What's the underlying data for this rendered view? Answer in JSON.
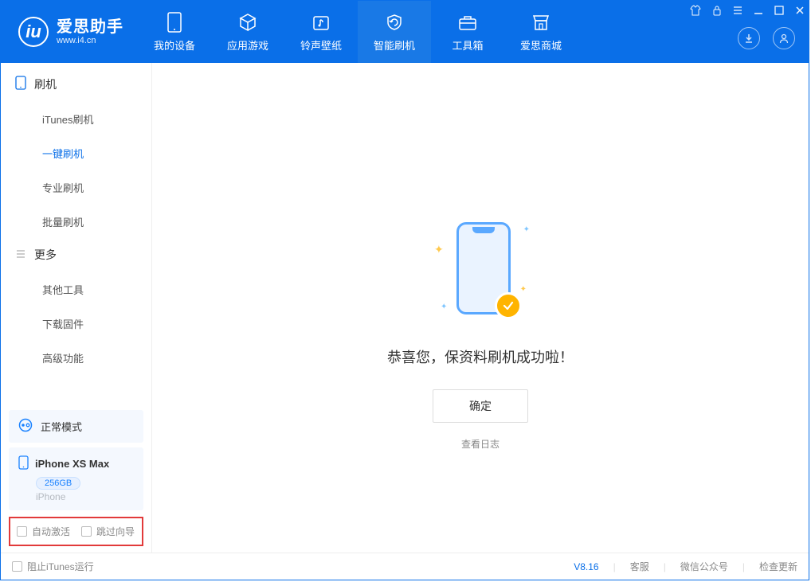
{
  "brand": {
    "name": "爱思助手",
    "url": "www.i4.cn"
  },
  "nav": {
    "items": [
      {
        "label": "我的设备"
      },
      {
        "label": "应用游戏"
      },
      {
        "label": "铃声壁纸"
      },
      {
        "label": "智能刷机"
      },
      {
        "label": "工具箱"
      },
      {
        "label": "爱思商城"
      }
    ]
  },
  "sidebar": {
    "section1_title": "刷机",
    "items1": [
      {
        "label": "iTunes刷机"
      },
      {
        "label": "一键刷机"
      },
      {
        "label": "专业刷机"
      },
      {
        "label": "批量刷机"
      }
    ],
    "section2_title": "更多",
    "items2": [
      {
        "label": "其他工具"
      },
      {
        "label": "下载固件"
      },
      {
        "label": "高级功能"
      }
    ],
    "mode_label": "正常模式",
    "device": {
      "name": "iPhone XS Max",
      "storage": "256GB",
      "type": "iPhone"
    },
    "auto_activate_label": "自动激活",
    "skip_guide_label": "跳过向导"
  },
  "main": {
    "success_message": "恭喜您，保资料刷机成功啦！",
    "ok_button": "确定",
    "view_log": "查看日志"
  },
  "footer": {
    "block_itunes_label": "阻止iTunes运行",
    "version": "V8.16",
    "customer_service": "客服",
    "wechat": "微信公众号",
    "check_update": "检查更新"
  }
}
